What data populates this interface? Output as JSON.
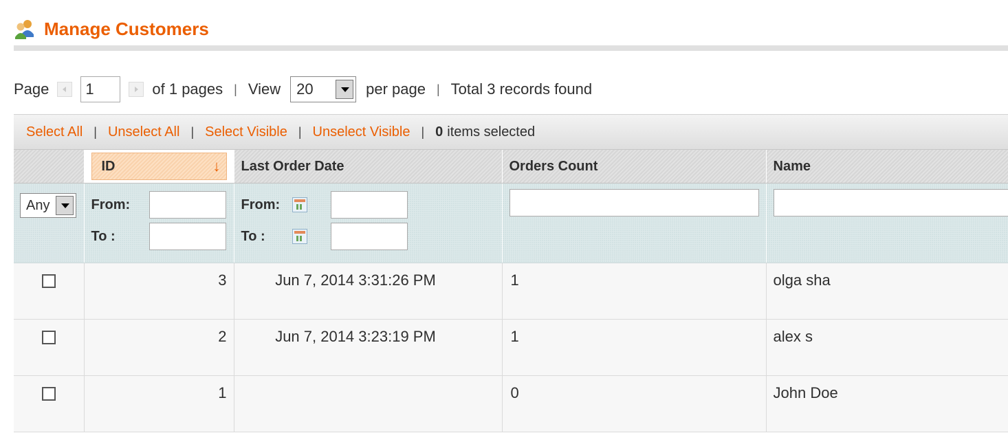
{
  "header": {
    "title": "Manage Customers",
    "icon": "customers-icon",
    "accent_color": "#eb5e00"
  },
  "pager": {
    "page_label": "Page",
    "current_page": "1",
    "of_pages": "of 1 pages",
    "view_label": "View",
    "per_page_value": "20",
    "per_page_label": "per page",
    "total_text": "Total 3 records found"
  },
  "massaction": {
    "select_all": "Select All",
    "unselect_all": "Unselect All",
    "select_visible": "Select Visible",
    "unselect_visible": "Unselect Visible",
    "selected_count": "0",
    "selected_label": "items selected"
  },
  "grid": {
    "columns": [
      "ID",
      "Last Order Date",
      "Orders Count",
      "Name"
    ],
    "sorted_column": "ID",
    "sort_direction": "desc",
    "filters": {
      "any_value": "Any",
      "from_label": "From:",
      "to_label": "To :"
    },
    "rows": [
      {
        "id": "3",
        "last_order_date": "Jun 7, 2014 3:31:26 PM",
        "orders_count": "1",
        "name": "olga sha"
      },
      {
        "id": "2",
        "last_order_date": "Jun 7, 2014 3:23:19 PM",
        "orders_count": "1",
        "name": "alex s"
      },
      {
        "id": "1",
        "last_order_date": "",
        "orders_count": "0",
        "name": "John Doe"
      }
    ]
  }
}
